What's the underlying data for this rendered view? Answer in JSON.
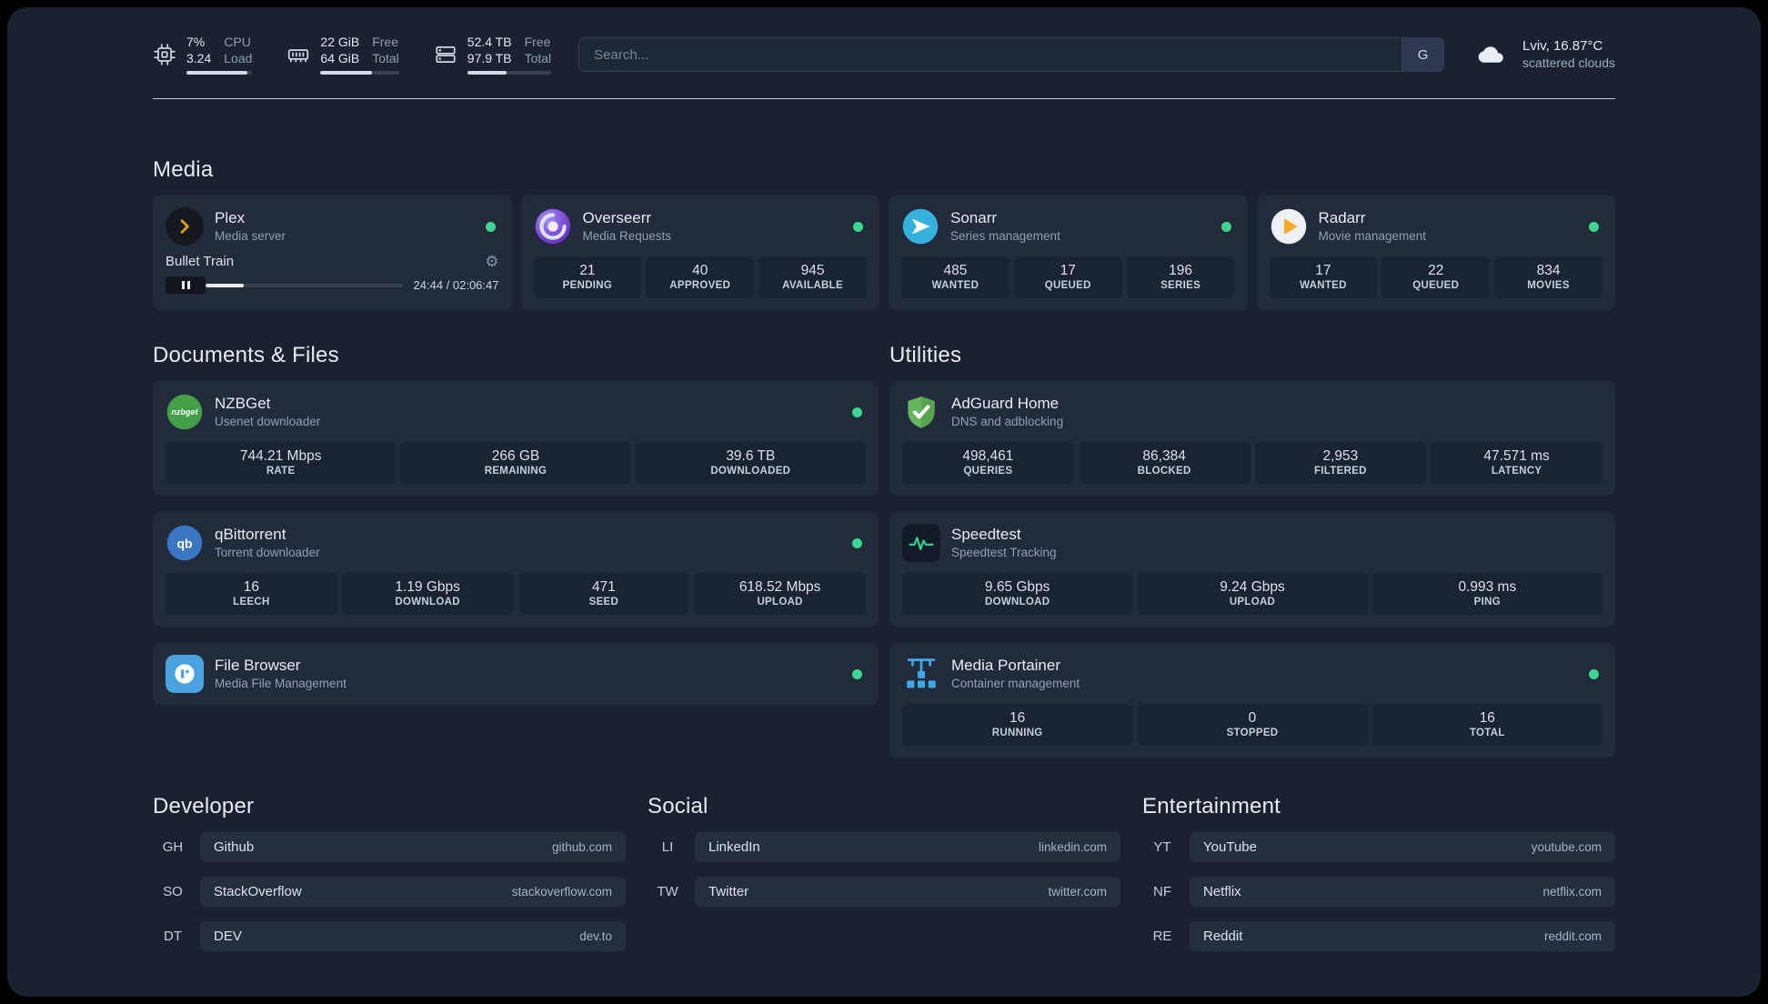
{
  "topbar": {
    "cpu": {
      "value1": "7%",
      "label1": "CPU",
      "value2": "3.24",
      "label2": "Load",
      "bar_percent": 92
    },
    "memory": {
      "value1": "22 GiB",
      "label1": "Free",
      "value2": "64 GiB",
      "label2": "Total",
      "bar_percent": 66
    },
    "disk": {
      "value1": "52.4 TB",
      "label1": "Free",
      "value2": "97.9 TB",
      "label2": "Total",
      "bar_percent": 47
    },
    "search": {
      "placeholder": "Search...",
      "provider_button": "G"
    },
    "weather": {
      "location": "Lviv, 16.87°C",
      "condition": "scattered clouds"
    }
  },
  "colors": {
    "status_online": "#3fd68f",
    "plex_accent": "#e5a00d",
    "overseerr_accent": "#6d28d9",
    "sonarr_accent": "#36b0dd",
    "radarr_accent": "#f7a824",
    "nzbget_accent": "#43a047",
    "qbittorrent_accent": "#3a77c2",
    "adguard_accent": "#67b561",
    "speedtest_accent": "#2fd08c",
    "portainer_accent": "#3fa9e6",
    "filebrowser_accent": "#4aa3e0"
  },
  "sections": {
    "media": {
      "title": "Media",
      "services": [
        {
          "name": "Plex",
          "desc": "Media server",
          "status": "online",
          "player": {
            "track_title": "Bullet Train",
            "time": "24:44 / 02:06:47",
            "state": "paused",
            "progress_percent": 19.5
          }
        },
        {
          "name": "Overseerr",
          "desc": "Media Requests",
          "status": "online",
          "stats": [
            {
              "value": "21",
              "label": "PENDING"
            },
            {
              "value": "40",
              "label": "APPROVED"
            },
            {
              "value": "945",
              "label": "AVAILABLE"
            }
          ]
        },
        {
          "name": "Sonarr",
          "desc": "Series management",
          "status": "online",
          "stats": [
            {
              "value": "485",
              "label": "WANTED"
            },
            {
              "value": "17",
              "label": "QUEUED"
            },
            {
              "value": "196",
              "label": "SERIES"
            }
          ]
        },
        {
          "name": "Radarr",
          "desc": "Movie management",
          "status": "online",
          "stats": [
            {
              "value": "17",
              "label": "WANTED"
            },
            {
              "value": "22",
              "label": "QUEUED"
            },
            {
              "value": "834",
              "label": "MOVIES"
            }
          ]
        }
      ]
    },
    "documents": {
      "title": "Documents & Files",
      "services": [
        {
          "name": "NZBGet",
          "desc": "Usenet downloader",
          "status": "online",
          "stats": [
            {
              "value": "744.21 Mbps",
              "label": "RATE"
            },
            {
              "value": "266 GB",
              "label": "REMAINING"
            },
            {
              "value": "39.6 TB",
              "label": "DOWNLOADED"
            }
          ]
        },
        {
          "name": "qBittorrent",
          "desc": "Torrent downloader",
          "status": "online",
          "stats": [
            {
              "value": "16",
              "label": "LEECH"
            },
            {
              "value": "1.19 Gbps",
              "label": "DOWNLOAD"
            },
            {
              "value": "471",
              "label": "SEED"
            },
            {
              "value": "618.52 Mbps",
              "label": "UPLOAD"
            }
          ]
        },
        {
          "name": "File Browser",
          "desc": "Media File Management",
          "status": "online"
        }
      ]
    },
    "utilities": {
      "title": "Utilities",
      "services": [
        {
          "name": "AdGuard Home",
          "desc": "DNS and adblocking",
          "stats": [
            {
              "value": "498,461",
              "label": "QUERIES"
            },
            {
              "value": "86,384",
              "label": "BLOCKED"
            },
            {
              "value": "2,953",
              "label": "FILTERED"
            },
            {
              "value": "47.571 ms",
              "label": "LATENCY"
            }
          ]
        },
        {
          "name": "Speedtest",
          "desc": "Speedtest Tracking",
          "stats": [
            {
              "value": "9.65 Gbps",
              "label": "DOWNLOAD"
            },
            {
              "value": "9.24 Gbps",
              "label": "UPLOAD"
            },
            {
              "value": "0.993 ms",
              "label": "PING"
            }
          ]
        },
        {
          "name": "Media Portainer",
          "desc": "Container management",
          "status": "online",
          "stats": [
            {
              "value": "16",
              "label": "RUNNING"
            },
            {
              "value": "0",
              "label": "STOPPED"
            },
            {
              "value": "16",
              "label": "TOTAL"
            }
          ]
        }
      ]
    }
  },
  "bookmark_groups": [
    {
      "title": "Developer",
      "items": [
        {
          "abbr": "GH",
          "name": "Github",
          "url": "github.com"
        },
        {
          "abbr": "SO",
          "name": "StackOverflow",
          "url": "stackoverflow.com"
        },
        {
          "abbr": "DT",
          "name": "DEV",
          "url": "dev.to"
        }
      ]
    },
    {
      "title": "Social",
      "items": [
        {
          "abbr": "LI",
          "name": "LinkedIn",
          "url": "linkedin.com"
        },
        {
          "abbr": "TW",
          "name": "Twitter",
          "url": "twitter.com"
        }
      ]
    },
    {
      "title": "Entertainment",
      "items": [
        {
          "abbr": "YT",
          "name": "YouTube",
          "url": "youtube.com"
        },
        {
          "abbr": "NF",
          "name": "Netflix",
          "url": "netflix.com"
        },
        {
          "abbr": "RE",
          "name": "Reddit",
          "url": "reddit.com"
        }
      ]
    }
  ]
}
